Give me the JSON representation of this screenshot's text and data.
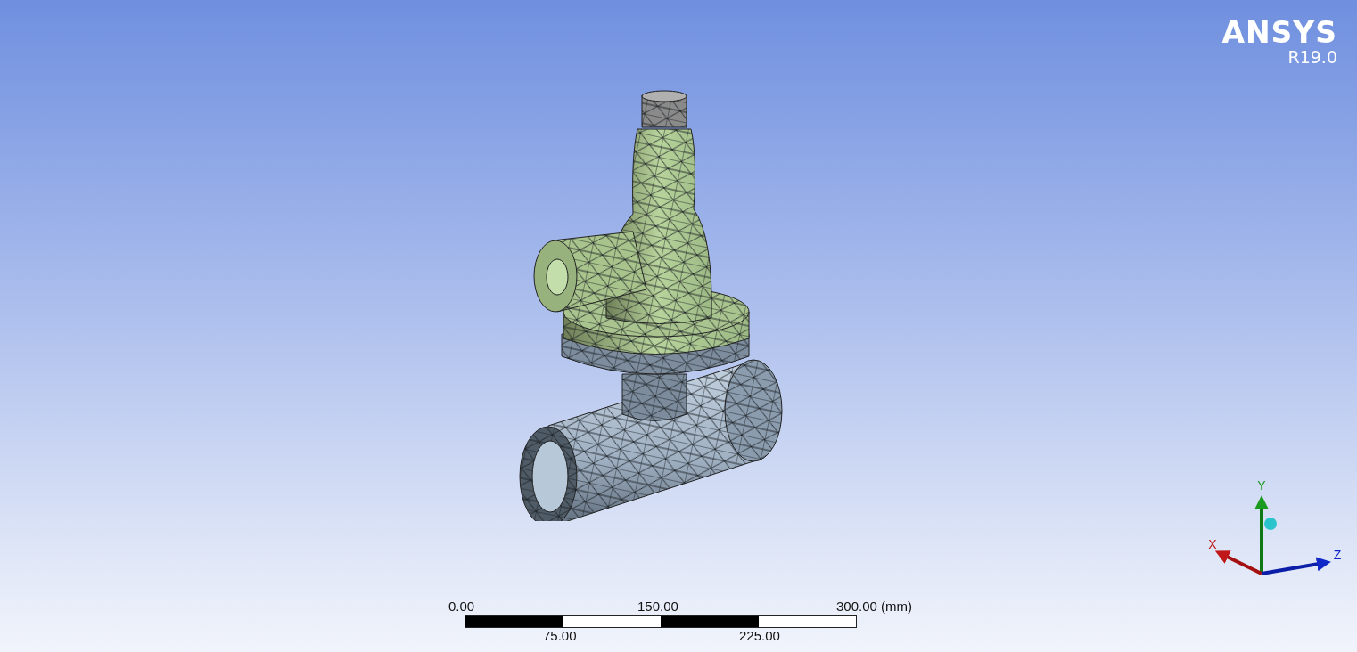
{
  "logo": {
    "name": "ANSYS",
    "version": "R19.0"
  },
  "triad": {
    "axes": [
      {
        "kind": "y",
        "label": "Y"
      },
      {
        "kind": "x",
        "label": "X"
      },
      {
        "kind": "z",
        "label": "Z"
      }
    ]
  },
  "scale_bar": {
    "top_labels": [
      "0.00",
      "150.00",
      "300.00 (mm)"
    ],
    "bottom_labels": [
      "75.00",
      "225.00"
    ]
  }
}
